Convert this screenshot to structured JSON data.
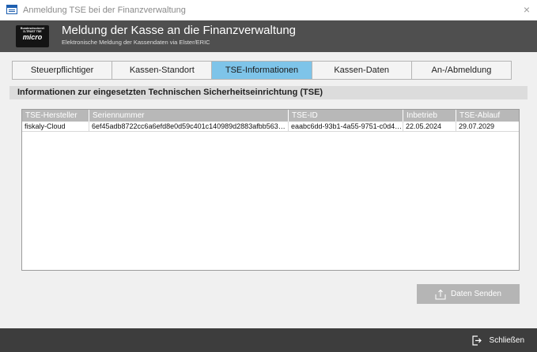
{
  "window": {
    "title": "Anmeldung TSE bei der Finanzverwaltung",
    "close_glyph": "×"
  },
  "header": {
    "logo_lines": [
      "Bundesdruckerei",
      "D-TRUST TSE",
      "micro"
    ],
    "title": "Meldung der Kasse an die Finanzverwaltung",
    "subtitle": "Elektronische Meldung der Kassendaten via Elster/ERIC"
  },
  "tabs": [
    {
      "label": "Steuerpflichtiger",
      "active": false
    },
    {
      "label": "Kassen-Standort",
      "active": false
    },
    {
      "label": "TSE-Informationen",
      "active": true
    },
    {
      "label": "Kassen-Daten",
      "active": false
    },
    {
      "label": "An-/Abmeldung",
      "active": false
    }
  ],
  "section": {
    "title": "Informationen zur eingesetzten Technischen Sicherheitseinrichtung (TSE)"
  },
  "table": {
    "columns": [
      "TSE-Hersteller",
      "Seriennummer",
      "TSE-ID",
      "Inbetrieb",
      "TSE-Ablauf"
    ],
    "rows": [
      [
        "fiskaly-Cloud",
        "6ef45adb8722cc6a6efd8e0d59c401c140989d2883afbb5639a3bb89...",
        "eaabc6dd-93b1-4a55-9751-c0d42869d...",
        "22.05.2024",
        "29.07.2029"
      ]
    ]
  },
  "actions": {
    "send_label": "Daten Senden",
    "close_label": "Schließen"
  },
  "colors": {
    "active_tab": "#7ec4e9",
    "header_bg": "#4f4f4f",
    "footer_bg": "#3d3d3d",
    "button_bg": "#b5b5b5"
  }
}
